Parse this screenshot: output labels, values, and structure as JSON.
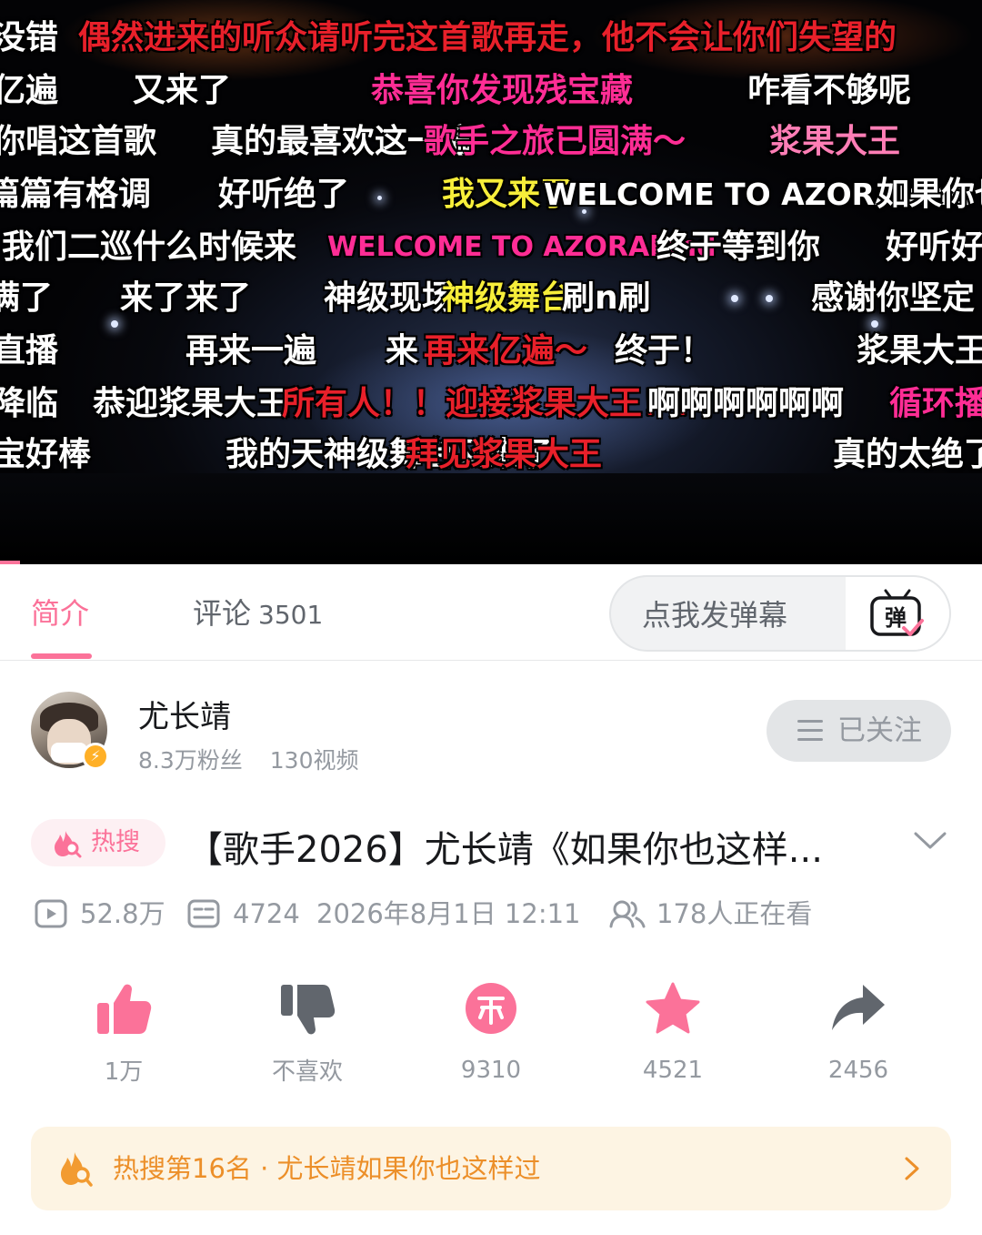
{
  "player": {
    "progress_fraction": 0.02,
    "danmaku": [
      {
        "text": "没错",
        "color": "#ffffff"
      },
      {
        "text": "偶然进来的听众请听完这首歌再走，他不会让你们失望的",
        "color": "#e8202a"
      },
      {
        "text": "亿遍",
        "color": "#ffffff"
      },
      {
        "text": "又来了",
        "color": "#ffffff"
      },
      {
        "text": "恭喜你发现残宝藏",
        "color": "#ff2d95"
      },
      {
        "text": "咋看不够呢",
        "color": "#ffffff"
      },
      {
        "text": "你唱这首歌",
        "color": "#ffffff"
      },
      {
        "text": "真的最喜欢这一遍",
        "color": "#ffffff"
      },
      {
        "text": "歌手之旅已圆满～",
        "color": "#ff2d95"
      },
      {
        "text": "浆果大王",
        "color": "#ff7eb6"
      },
      {
        "text": "篇篇有格调",
        "color": "#ffffff"
      },
      {
        "text": "好听绝了",
        "color": "#ffffff"
      },
      {
        "text": "我又来了",
        "color": "#f7ee3a"
      },
      {
        "text": "WELCOME TO AZORAland",
        "color": "#ffffff"
      },
      {
        "text": "如果你也",
        "color": "#ffffff"
      },
      {
        "text": "我们二巡什么时候来",
        "color": "#ffffff"
      },
      {
        "text": "WELCOME TO AZORAland",
        "color": "#ff2d95"
      },
      {
        "text": "终于等到你",
        "color": "#ffffff"
      },
      {
        "text": "好听好",
        "color": "#ffffff"
      },
      {
        "text": "满了",
        "color": "#ffffff"
      },
      {
        "text": "来了来了",
        "color": "#ffffff"
      },
      {
        "text": "神级现场",
        "color": "#ffffff"
      },
      {
        "text": "神级舞台",
        "color": "#f7ee3a"
      },
      {
        "text": "刷n刷",
        "color": "#ffffff"
      },
      {
        "text": "感谢你坚定",
        "color": "#ffffff"
      },
      {
        "text": "直播",
        "color": "#ffffff"
      },
      {
        "text": "再来一遍",
        "color": "#ffffff"
      },
      {
        "text": "来",
        "color": "#ffffff"
      },
      {
        "text": "再来亿遍～",
        "color": "#e8202a"
      },
      {
        "text": "终于！",
        "color": "#ffffff"
      },
      {
        "text": "浆果大王",
        "color": "#ffffff"
      },
      {
        "text": "降临",
        "color": "#ffffff"
      },
      {
        "text": "恭迎浆果大王",
        "color": "#ffffff"
      },
      {
        "text": "所有人！！迎接浆果大王！！",
        "color": "#e8202a"
      },
      {
        "text": "啊啊啊啊啊啊",
        "color": "#ffffff"
      },
      {
        "text": "循环播",
        "color": "#ff2d95"
      },
      {
        "text": "宝好棒",
        "color": "#ffffff"
      },
      {
        "text": "我的天神级舞台又来了",
        "color": "#ffffff"
      },
      {
        "text": "拜见浆果大王",
        "color": "#e8202a"
      },
      {
        "text": "真的太绝了",
        "color": "#ffffff"
      }
    ]
  },
  "tabs": {
    "intro": "简介",
    "comments": "评论",
    "comments_count": "3501"
  },
  "danmaku_input": {
    "placeholder": "点我发弹幕",
    "send_icon": "danmaku-toggle-icon",
    "send_glyph": "弹"
  },
  "uploader": {
    "name": "尤长靖",
    "fans": "8.3万粉丝",
    "videos": "130视频",
    "follow_label": "已关注"
  },
  "video": {
    "hot_tag": "热搜",
    "title": "【歌手2026】尤长靖《如果你也这样...",
    "views": "52.8万",
    "danmaku_count": "4724",
    "date": "2026年8月1日 12:11",
    "watching": "178人正在看"
  },
  "actions": {
    "like": "1万",
    "dislike": "不喜欢",
    "coin": "9310",
    "favorite": "4521",
    "share": "2456"
  },
  "hot_banner": {
    "text": "热搜第16名 · 尤长靖如果你也这样过"
  },
  "colors": {
    "accent": "#fb7299",
    "muted": "#9499a0",
    "hot_orange": "#ec8f29",
    "hot_banner_bg": "#fdf4e3"
  }
}
